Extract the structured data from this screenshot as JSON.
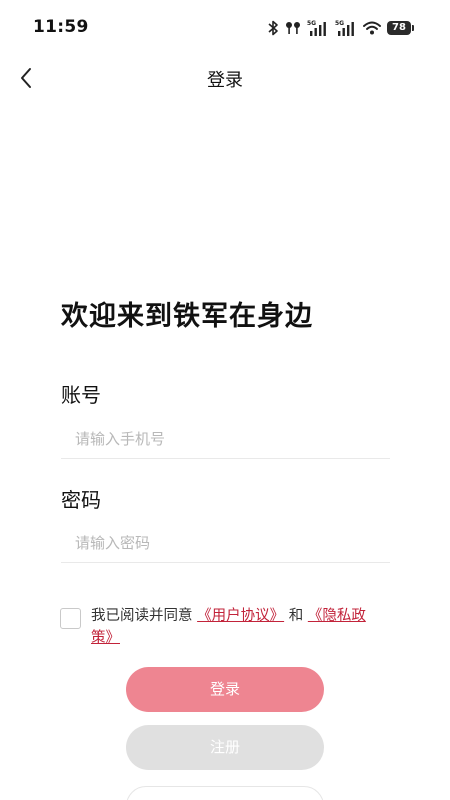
{
  "status_bar": {
    "time": "11:59",
    "battery": "78",
    "icons": [
      "bluetooth-icon",
      "earbuds-icon",
      "signal-5g-icon",
      "signal-5g-icon",
      "wifi-icon",
      "battery-icon"
    ]
  },
  "header": {
    "title": "登录",
    "back_icon": "chevron-left-icon"
  },
  "main": {
    "welcome": "欢迎来到铁军在身边",
    "account": {
      "label": "账号",
      "placeholder": "请输入手机号",
      "value": ""
    },
    "password": {
      "label": "密码",
      "placeholder": "请输入密码",
      "value": ""
    },
    "agreement": {
      "checked": false,
      "prefix": "我已阅读并同意",
      "user_agreement": "《用户协议》",
      "conjunction": "和",
      "privacy_policy": "《隐私政策》"
    },
    "login_label": "登录",
    "register_label": "注册"
  },
  "colors": {
    "accent": "#ee8591",
    "link": "#c2233a",
    "disabled": "#e0e0e0"
  }
}
